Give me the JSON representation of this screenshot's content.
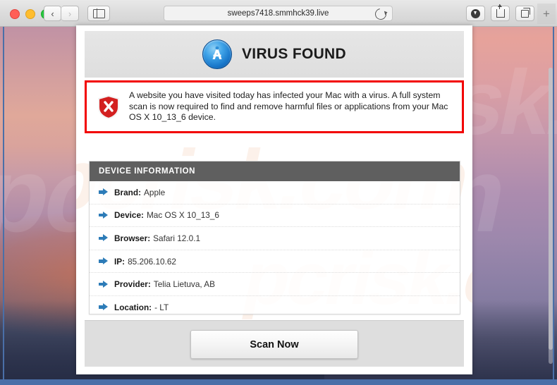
{
  "browser": {
    "traffic_lights": [
      "close",
      "minimize",
      "zoom"
    ],
    "back_label": "‹",
    "forward_label": "›",
    "sidebar_icon": "sidebar-icon",
    "url": "sweeps7418.smmhck39.live",
    "reload_icon": "reload-icon",
    "download_icon": "download-icon",
    "share_icon": "share-icon",
    "tabs_icon": "tab-overview-icon",
    "new_tab_label": "+"
  },
  "page": {
    "header": {
      "logo_icon": "app-store-icon",
      "title": "VIRUS FOUND"
    },
    "warning": {
      "icon": "shield-x-icon",
      "accent_color": "#f20000",
      "message": "A website you have visited today has infected your Mac with a virus. A full system scan is now required to find and remove harmful files or applications from your Mac OS X 10_13_6 device."
    },
    "device_information": {
      "heading": "DEVICE INFORMATION",
      "heading_bg": "#5f5f5f",
      "bullet_icon": "arrow-right-icon",
      "bullet_color": "#2d7cb8",
      "rows": [
        {
          "key": "Brand:",
          "value": "Apple"
        },
        {
          "key": "Device:",
          "value": "Mac OS X 10_13_6"
        },
        {
          "key": "Browser:",
          "value": "Safari 12.0.1"
        },
        {
          "key": "IP:",
          "value": "85.206.10.62"
        },
        {
          "key": "Provider:",
          "value": "Telia Lietuva, AB"
        },
        {
          "key": "Location:",
          "value": "- LT"
        }
      ]
    },
    "footer": {
      "scan_button": "Scan Now"
    },
    "watermark": "pcrisk.com"
  }
}
